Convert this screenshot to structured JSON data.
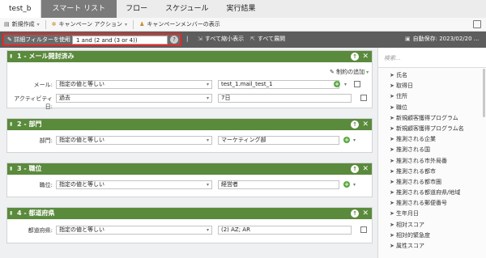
{
  "tabs": [
    {
      "label": "test_b"
    },
    {
      "label": "スマート リスト"
    },
    {
      "label": "フロー"
    },
    {
      "label": "スケジュール"
    },
    {
      "label": "実行結果"
    }
  ],
  "toolbar": {
    "new_label": "新規作成",
    "campaign_action_label": "キャンペーン アクション",
    "show_members_label": "キャンペーンメンバーの表示"
  },
  "filterbar": {
    "advanced_label": "詳細フィルターを使用",
    "advanced_value": "1 and (2 and (3 or 4))",
    "help": "?",
    "collapse_all": "すべて縮小表示",
    "expand_all": "すべて展開",
    "autosave": "自動保存: 2023/02/20 ..."
  },
  "filters": [
    {
      "title": "1 - メール開封済み",
      "constraint_label": "制約の追加",
      "rows": [
        {
          "label": "メール:",
          "operator": "指定の値と等しい",
          "value": "test_1.mail_test_1"
        },
        {
          "label": "アクティビティ日:",
          "operator": "過去",
          "value": "7日"
        }
      ]
    },
    {
      "title": "2 - 部門",
      "rows": [
        {
          "label": "部門:",
          "operator": "指定の値と等しい",
          "value": "マーケティング部"
        }
      ]
    },
    {
      "title": "3 - 職位",
      "rows": [
        {
          "label": "職位:",
          "operator": "指定の値と等しい",
          "value": "経営者"
        }
      ]
    },
    {
      "title": "4 - 都道府県",
      "rows": [
        {
          "label": "都道府県:",
          "operator": "指定の値と等しい",
          "value": "(2) AZ; AR"
        }
      ]
    }
  ],
  "right_panel": {
    "search_placeholder": "検索...",
    "fields": [
      "氏名",
      "取得日",
      "住所",
      "職位",
      "新規顧客獲得プログラム",
      "新規顧客獲得プログラム名",
      "推測される企業",
      "推測される国",
      "推測される市外局番",
      "推測される都市",
      "推測される都市圏",
      "推測される都道府県/地域",
      "推測される郵便番号",
      "生年月日",
      "相対スコア",
      "相対的緊急度",
      "属性スコア"
    ]
  },
  "colors": {
    "card_header": "#5a8a3c",
    "filter_bar": "#5d5d5d",
    "highlight": "#e02b2b",
    "active_tab": "#7b7b7b"
  }
}
